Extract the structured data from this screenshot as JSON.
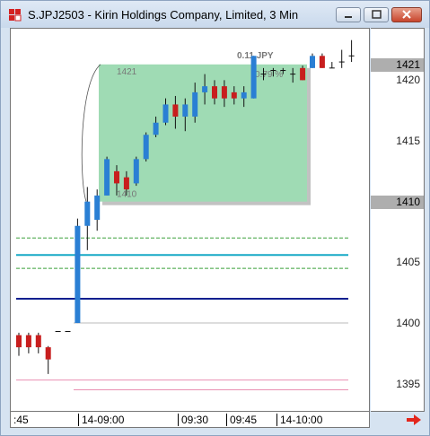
{
  "window": {
    "title": "S.JPJ2503 - Kirin Holdings Company, Limited, 3 Min",
    "icons": {
      "app": "trading-app-icon",
      "minimize": "minimize-icon",
      "maximize": "maximize-icon",
      "close": "close-icon",
      "scroll": "arrow-right-icon"
    }
  },
  "axis": {
    "price_ticks": [
      "1420",
      "1415",
      "1410",
      "1405",
      "1400",
      "1395"
    ],
    "price_labels": [
      "1421",
      "1410"
    ],
    "time_ticks": [
      ":45",
      "14-09:00",
      "09:30",
      "09:45",
      "14-10:00"
    ]
  },
  "overlay": {
    "box_top_price": "1421",
    "box_bottom_price": "1410",
    "pnl_text": "0.11 JPY",
    "pct_text": "0.79 %"
  },
  "colors": {
    "up": "#2a7fd4",
    "down": "#c81e1e",
    "box": "#9fdbb4",
    "cyan_line": "#16a9c5",
    "navy_line": "#0b1f8f",
    "green_dash": "#3aa03a",
    "pink_line": "#e98fb2",
    "close_button": "#c8452c"
  },
  "chart_data": {
    "type": "candlestick",
    "symbol": "S.JPJ2503",
    "interval": "3 Min",
    "y_range": [
      1393.5,
      1423.5
    ],
    "horizontal_levels": [
      {
        "price": 1407.0,
        "style": "green-dashed"
      },
      {
        "price": 1405.6,
        "style": "cyan-solid"
      },
      {
        "price": 1404.5,
        "style": "green-dashed"
      },
      {
        "price": 1402.0,
        "style": "navy-solid"
      },
      {
        "price": 1395.3,
        "style": "pink-solid"
      },
      {
        "price": 1394.5,
        "style": "pink-solid"
      }
    ],
    "candles": [
      {
        "i": 0,
        "open": 1399.0,
        "close": 1398.0,
        "high": 1399.2,
        "low": 1397.3
      },
      {
        "i": 1,
        "open": 1399.0,
        "close": 1398.0,
        "high": 1399.2,
        "low": 1397.5
      },
      {
        "i": 2,
        "open": 1399.0,
        "close": 1398.0,
        "high": 1399.2,
        "low": 1397.5
      },
      {
        "i": 3,
        "open": 1398.0,
        "close": 1397.0,
        "high": 1398.1,
        "low": 1395.8
      },
      {
        "i": 4,
        "open": 1399.3,
        "close": 1399.3,
        "high": 1399.3,
        "low": 1399.3
      },
      {
        "i": 5,
        "open": 1399.3,
        "close": 1399.3,
        "high": 1399.3,
        "low": 1399.3
      },
      {
        "i": 6,
        "open": 1400.0,
        "close": 1408.0,
        "high": 1408.6,
        "low": 1400.0
      },
      {
        "i": 7,
        "open": 1408.0,
        "close": 1410.0,
        "high": 1411.2,
        "low": 1406.0
      },
      {
        "i": 8,
        "open": 1408.5,
        "close": 1410.5,
        "high": 1411.0,
        "low": 1407.6
      },
      {
        "i": 9,
        "open": 1410.5,
        "close": 1413.5,
        "high": 1413.7,
        "low": 1410.5
      },
      {
        "i": 10,
        "open": 1412.5,
        "close": 1411.5,
        "high": 1413.0,
        "low": 1410.5
      },
      {
        "i": 11,
        "open": 1412.0,
        "close": 1411.0,
        "high": 1412.5,
        "low": 1410.5
      },
      {
        "i": 12,
        "open": 1411.5,
        "close": 1413.5,
        "high": 1413.7,
        "low": 1411.3
      },
      {
        "i": 13,
        "open": 1413.5,
        "close": 1415.5,
        "high": 1415.7,
        "low": 1413.3
      },
      {
        "i": 14,
        "open": 1415.5,
        "close": 1416.5,
        "high": 1417.0,
        "low": 1415.3
      },
      {
        "i": 15,
        "open": 1416.5,
        "close": 1418.0,
        "high": 1418.5,
        "low": 1416.3
      },
      {
        "i": 16,
        "open": 1418.0,
        "close": 1417.0,
        "high": 1418.7,
        "low": 1416.0
      },
      {
        "i": 17,
        "open": 1417.0,
        "close": 1418.0,
        "high": 1418.5,
        "low": 1415.8
      },
      {
        "i": 18,
        "open": 1417.0,
        "close": 1419.0,
        "high": 1419.8,
        "low": 1416.5
      },
      {
        "i": 19,
        "open": 1419.0,
        "close": 1419.5,
        "high": 1420.5,
        "low": 1418.0
      },
      {
        "i": 20,
        "open": 1419.5,
        "close": 1418.5,
        "high": 1420.0,
        "low": 1418.0
      },
      {
        "i": 21,
        "open": 1419.5,
        "close": 1418.5,
        "high": 1420.0,
        "low": 1417.8
      },
      {
        "i": 22,
        "open": 1419.0,
        "close": 1418.5,
        "high": 1419.5,
        "low": 1418.0
      },
      {
        "i": 23,
        "open": 1418.5,
        "close": 1419.0,
        "high": 1419.5,
        "low": 1417.8
      },
      {
        "i": 24,
        "open": 1418.5,
        "close": 1422.0,
        "high": 1422.0,
        "low": 1418.5
      },
      {
        "i": 25,
        "open": 1420.5,
        "close": 1420.5,
        "high": 1421.0,
        "low": 1420.0
      },
      {
        "i": 26,
        "open": 1420.8,
        "close": 1420.8,
        "high": 1421.0,
        "low": 1420.3
      },
      {
        "i": 27,
        "open": 1420.8,
        "close": 1420.8,
        "high": 1421.0,
        "low": 1420.5
      },
      {
        "i": 28,
        "open": 1420.5,
        "close": 1420.5,
        "high": 1421.0,
        "low": 1419.8
      },
      {
        "i": 29,
        "open": 1421.0,
        "close": 1420.0,
        "high": 1421.2,
        "low": 1420.0
      },
      {
        "i": 30,
        "open": 1421.0,
        "close": 1422.0,
        "high": 1422.2,
        "low": 1421.0
      },
      {
        "i": 31,
        "open": 1422.0,
        "close": 1421.0,
        "high": 1422.2,
        "low": 1421.0
      },
      {
        "i": 32,
        "open": 1421.0,
        "close": 1421.0,
        "high": 1421.5,
        "low": 1421.0
      },
      {
        "i": 33,
        "open": 1421.5,
        "close": 1421.5,
        "high": 1422.5,
        "low": 1421.0
      },
      {
        "i": 34,
        "open": 1422.0,
        "close": 1422.0,
        "high": 1423.3,
        "low": 1421.5
      }
    ]
  }
}
